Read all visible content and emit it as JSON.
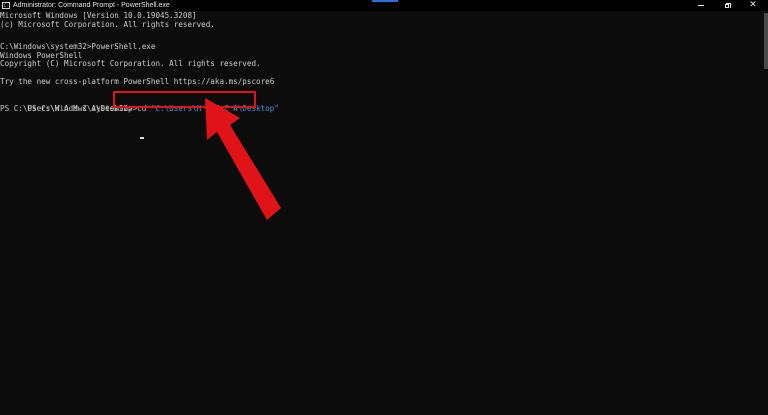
{
  "window": {
    "title": "Administrator: Command Prompt - PowerShell.exe",
    "app_icon_glyph": "C:\\",
    "controls": {
      "minimize_icon": "minimize-icon",
      "maximize_icon": "restore-icon",
      "close_glyph": "✕"
    }
  },
  "console": {
    "lines": [
      "Microsoft Windows [Version 10.0.19045.3208]",
      "(c) Microsoft Corporation. All rights reserved.",
      "",
      "C:\\Windows\\system32>PowerShell.exe",
      "Windows PowerShell",
      "Copyright (C) Microsoft Corporation. All rights reserved.",
      "",
      "Try the new cross-platform PowerShell https://aka.ms/pscore6",
      "",
      "PS C:\\Windows\\system32> cd \"C:\\Users\\H A M Z A\\Desktop\"",
      "PS C:\\Users\\H A M Z A\\Desktop>"
    ],
    "command_prompt": "PS C:\\Windows\\system32> cd ",
    "command_argument": "\"C:\\Users\\H A M Z A\\Desktop\"",
    "current_prompt": "PS C:\\Users\\H A M Z A\\Desktop>",
    "colors": {
      "background": "#0c0c0c",
      "text": "#cccccc",
      "argument": "#3a96dd"
    }
  },
  "annotation": {
    "color": "#e01418",
    "shape": "red-box-and-arrow"
  }
}
